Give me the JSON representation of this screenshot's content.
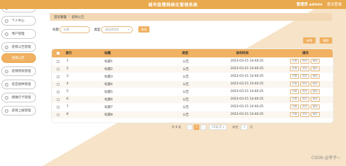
{
  "header": {
    "title": "城市疫情网络化管理系统",
    "admin_text": "管理员 admin",
    "logout_label": "退出登录"
  },
  "sidebar": {
    "items": [
      {
        "label": "系统首页",
        "active": false
      },
      {
        "label": "个人中心",
        "active": false
      },
      {
        "label": "用户管理",
        "active": false
      },
      {
        "label": "疫情公告管理",
        "active": false
      },
      {
        "label": "疫情公告",
        "active": true
      },
      {
        "label": "疫情物资管理",
        "active": false
      },
      {
        "label": "疫苗接种管理",
        "active": false
      },
      {
        "label": "健康打卡管理",
        "active": false
      },
      {
        "label": "疫情上报管理",
        "active": false
      }
    ]
  },
  "breadcrumb": {
    "home": "首页管理",
    "current": "疫情公告"
  },
  "search": {
    "title_label": "标题",
    "title_placeholder": "标题",
    "type_label": "类型",
    "type_placeholder": "请选择类型",
    "query_button": "查询"
  },
  "actions": {
    "add": "新增",
    "delete": "删除"
  },
  "table": {
    "headers": [
      "索引",
      "标题",
      "类型",
      "发布时间",
      "操作"
    ],
    "rows": [
      {
        "index": "1",
        "title": "标题1",
        "type": "公告",
        "time": "2023-03-15 14:46:25"
      },
      {
        "index": "2",
        "title": "标题2",
        "type": "公告",
        "time": "2023-03-15 14:46:25"
      },
      {
        "index": "3",
        "title": "标题3",
        "type": "公告",
        "time": "2023-03-15 14:46:25"
      },
      {
        "index": "4",
        "title": "标题4",
        "type": "公告",
        "time": "2023-03-15 14:46:25"
      },
      {
        "index": "5",
        "title": "标题5",
        "type": "公告",
        "time": "2023-03-15 14:46:25"
      },
      {
        "index": "6",
        "title": "标题6",
        "type": "公告",
        "time": "2023-03-15 14:46:25"
      },
      {
        "index": "7",
        "title": "标题7",
        "type": "公告",
        "time": "2023-03-15 14:46:25"
      },
      {
        "index": "8",
        "title": "标题8",
        "type": "公告",
        "time": "2023-03-15 14:46:25"
      }
    ],
    "op_labels": [
      "详情",
      "修改",
      "删除"
    ]
  },
  "pagination": {
    "total": "共 8 条",
    "prev": "‹",
    "page": "1",
    "next": "›",
    "page_size": "10条/页",
    "goto_label": "前往",
    "goto_value": "1",
    "page_unit": "页"
  },
  "watermark": "CSDN @李子~"
}
